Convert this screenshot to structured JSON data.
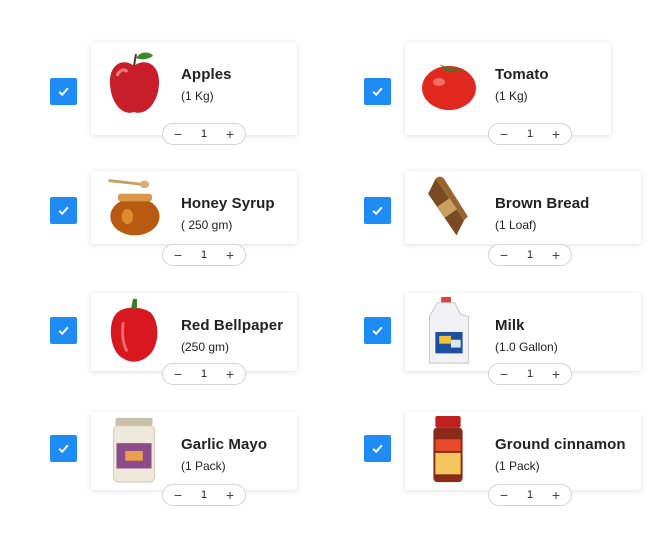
{
  "colors": {
    "checkbox": "#1f8cf5",
    "card_shadow": "#e0e0e0"
  },
  "stepper": {
    "minus": "−",
    "plus": "+"
  },
  "items": [
    {
      "name": "Apples",
      "qty": "(1 Kg)",
      "count": "1",
      "checked": true,
      "image": "apple"
    },
    {
      "name": "Tomato",
      "qty": "(1 Kg)",
      "count": "1",
      "checked": true,
      "image": "tomato"
    },
    {
      "name": "Honey Syrup",
      "qty": "( 250 gm)",
      "count": "1",
      "checked": true,
      "image": "honey-jar"
    },
    {
      "name": "Brown Bread",
      "qty": "(1 Loaf)",
      "count": "1",
      "checked": true,
      "image": "bread-loaf"
    },
    {
      "name": "Red Bellpaper",
      "qty": "(250 gm)",
      "count": "1",
      "checked": true,
      "image": "bell-pepper"
    },
    {
      "name": "Milk",
      "qty": "(1.0 Gallon)",
      "count": "1",
      "checked": true,
      "image": "milk-jug"
    },
    {
      "name": "Garlic Mayo",
      "qty": "(1 Pack)",
      "count": "1",
      "checked": true,
      "image": "mayo-jar"
    },
    {
      "name": "Ground cinnamon",
      "qty": "(1 Pack)",
      "count": "1",
      "checked": true,
      "image": "spice-bottle"
    }
  ]
}
